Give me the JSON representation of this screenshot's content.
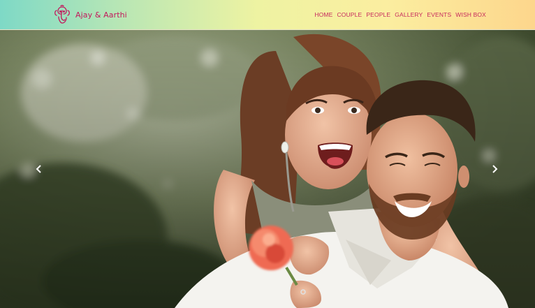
{
  "brand": {
    "name": "Ajay & Aarthi",
    "logo_icon": "ganesha-logo-icon",
    "color": "#c2185b"
  },
  "nav": {
    "items": [
      {
        "label": "HOME"
      },
      {
        "label": "COUPLE"
      },
      {
        "label": "PEOPLE"
      },
      {
        "label": "GALLERY"
      },
      {
        "label": "EVENTS"
      },
      {
        "label": "WISH BOX"
      }
    ],
    "color": "#c62a5e"
  },
  "carousel": {
    "prev_icon": "chevron-left-icon",
    "next_icon": "chevron-right-icon"
  }
}
